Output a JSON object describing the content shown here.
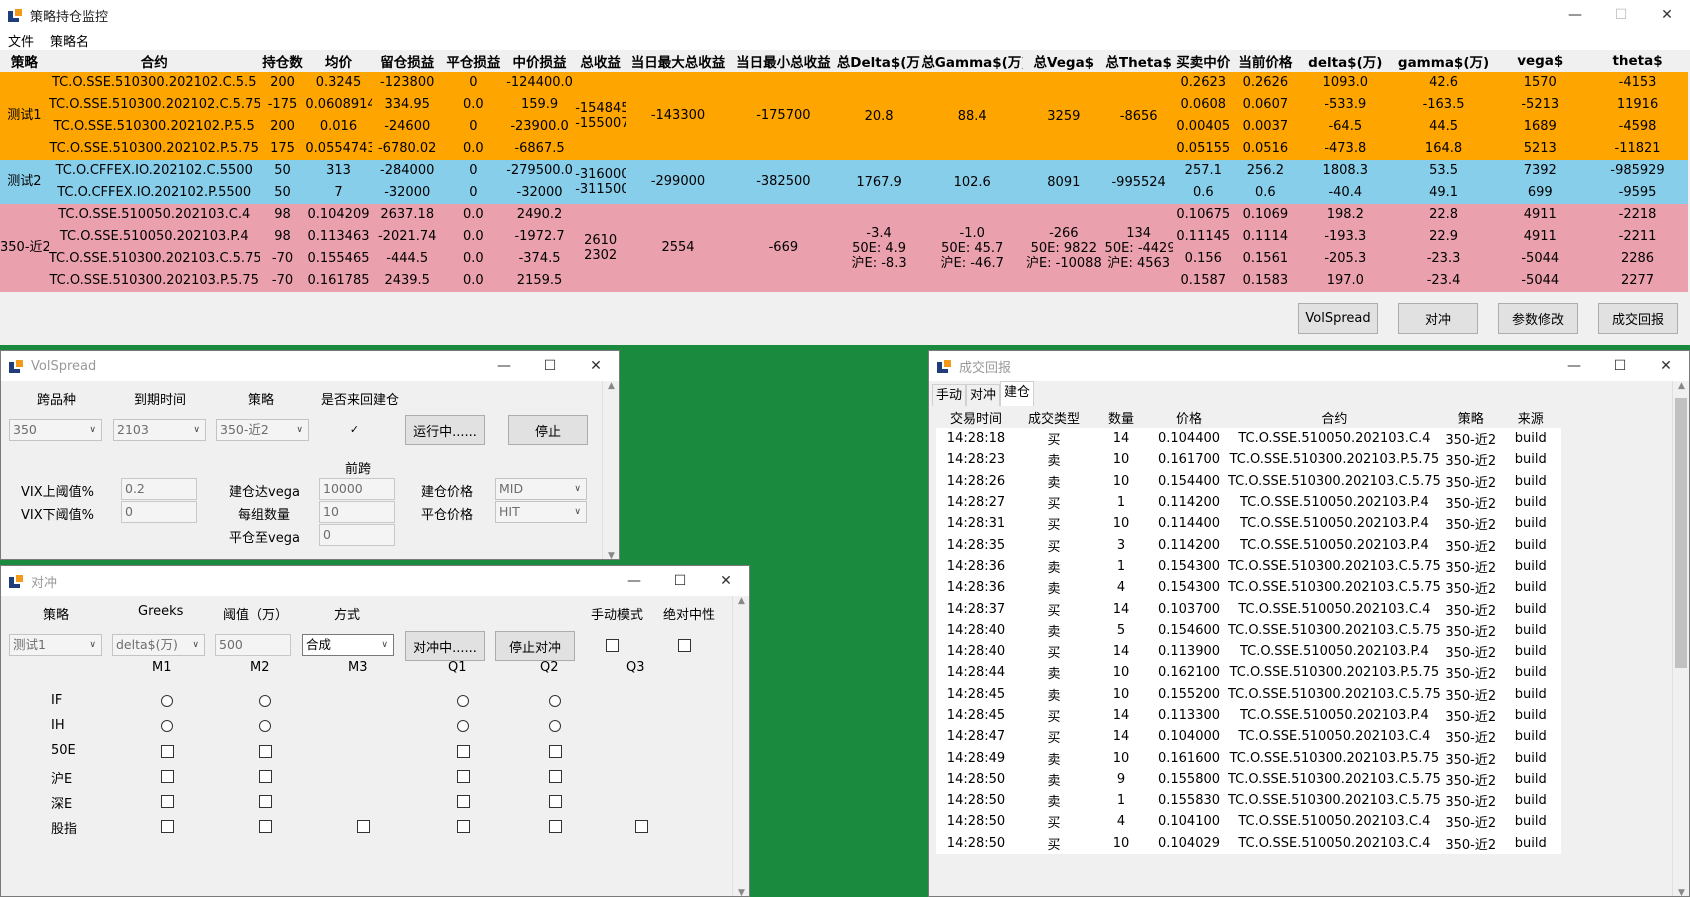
{
  "main": {
    "title": "策略持仓监控",
    "menu": [
      "文件",
      "策略名"
    ],
    "columns": [
      "策略",
      "合约",
      "持仓数",
      "均价",
      "留仓损益",
      "平仓损益",
      "中价损益",
      "总收益",
      "当日最大总收益",
      "当日最小总收益",
      "总Delta$(万)",
      "总Gamma$(万)",
      "总Vega$",
      "总Theta$",
      "买卖中价",
      "当前价格",
      "delta$(万)",
      "gamma$(万)",
      "vega$",
      "theta$"
    ],
    "groups": [
      {
        "name": "测试1",
        "color": "#ffa500",
        "total": [
          "-154845",
          "-155007"
        ],
        "max": "-143300",
        "min": "-175700",
        "delta": [
          "20.8"
        ],
        "gamma": [
          "88.4"
        ],
        "vega": [
          "3259"
        ],
        "theta": [
          "-8656"
        ],
        "rows": [
          [
            "TC.O.SSE.510300.202102.C.5.5",
            "200",
            "0.3245",
            "-123800",
            "0",
            "-124400.0",
            "0.2623",
            "0.2626",
            "1093.0",
            "42.6",
            "1570",
            "-4153"
          ],
          [
            "TC.O.SSE.510300.202102.C.5.75",
            "-175",
            "0.0608914",
            "334.95",
            "0.0",
            "159.9",
            "0.0608",
            "0.0607",
            "-533.9",
            "-163.5",
            "-5213",
            "11916"
          ],
          [
            "TC.O.SSE.510300.202102.P.5.5",
            "200",
            "0.016",
            "-24600",
            "0",
            "-23900.0",
            "0.00405",
            "0.0037",
            "-64.5",
            "44.5",
            "1689",
            "-4598"
          ],
          [
            "TC.O.SSE.510300.202102.P.5.75",
            "175",
            "0.0554743",
            "-6780.02",
            "0.0",
            "-6867.5",
            "0.05155",
            "0.0516",
            "-473.8",
            "164.8",
            "5213",
            "-11821"
          ]
        ]
      },
      {
        "name": "测试2",
        "color": "#87ceeb",
        "total": [
          "-316000",
          "-311500"
        ],
        "max": "-299000",
        "min": "-382500",
        "delta": [
          "1767.9"
        ],
        "gamma": [
          "102.6"
        ],
        "vega": [
          "8091"
        ],
        "theta": [
          "-995524"
        ],
        "rows": [
          [
            "TC.O.CFFEX.IO.202102.C.5500",
            "50",
            "313",
            "-284000",
            "0",
            "-279500.0",
            "257.1",
            "256.2",
            "1808.3",
            "53.5",
            "7392",
            "-985929"
          ],
          [
            "TC.O.CFFEX.IO.202102.P.5500",
            "50",
            "7",
            "-32000",
            "0",
            "-32000",
            "0.6",
            "0.6",
            "-40.4",
            "49.1",
            "699",
            "-9595"
          ]
        ]
      },
      {
        "name": "350-近2",
        "color": "#eaa0ad",
        "total": [
          "2610",
          "2302"
        ],
        "max": "2554",
        "min": "-669",
        "delta": [
          "-3.4",
          "50E: 4.9",
          "沪E: -8.3"
        ],
        "gamma": [
          "-1.0",
          "50E: 45.7",
          "沪E: -46.7"
        ],
        "vega": [
          "-266",
          "50E: 9822",
          "沪E: -10088"
        ],
        "theta": [
          "134",
          "50E: -4429",
          "沪E: 4563"
        ],
        "rows": [
          [
            "TC.O.SSE.510050.202103.C.4",
            "98",
            "0.104209",
            "2637.18",
            "0.0",
            "2490.2",
            "0.10675",
            "0.1069",
            "198.2",
            "22.8",
            "4911",
            "-2218"
          ],
          [
            "TC.O.SSE.510050.202103.P.4",
            "98",
            "0.113463",
            "-2021.74",
            "0.0",
            "-1972.7",
            "0.11145",
            "0.1114",
            "-193.3",
            "22.9",
            "4911",
            "-2211"
          ],
          [
            "TC.O.SSE.510300.202103.C.5.75",
            "-70",
            "0.155465",
            "-444.5",
            "0.0",
            "-374.5",
            "0.156",
            "0.1561",
            "-205.3",
            "-23.3",
            "-5044",
            "2286"
          ],
          [
            "TC.O.SSE.510300.202103.P.5.75",
            "-70",
            "0.161785",
            "2439.5",
            "0.0",
            "2159.5",
            "0.1587",
            "0.1583",
            "197.0",
            "-23.4",
            "-5044",
            "2277"
          ]
        ]
      }
    ],
    "buttons": [
      "VolSpread",
      "对冲",
      "参数修改",
      "成交回报"
    ]
  },
  "volspread": {
    "title": "VolSpread",
    "labels": {
      "product": "跨品种",
      "expiry": "到期时间",
      "strategy": "策略",
      "reopen": "是否来回建仓",
      "front": "前跨",
      "vix_up": "VIX上阈值%",
      "vix_down": "VIX下阈值%",
      "open_vega": "建仓达vega",
      "per_group": "每组数量",
      "close_vega": "平仓至vega",
      "open_price": "建仓价格",
      "close_price": "平仓价格"
    },
    "values": {
      "product": "350",
      "expiry": "2103",
      "strategy": "350-近2",
      "vix_up": "0.2",
      "vix_down": "0",
      "open_vega": "10000",
      "per_group": "10",
      "close_vega": "0",
      "open_price": "MID",
      "close_price": "HIT"
    },
    "run_btn": "运行中......",
    "stop_btn": "停止",
    "reopen_checked": "✓"
  },
  "hedge": {
    "title": "对冲",
    "labels": {
      "strategy": "策略",
      "greeks": "Greeks",
      "threshold": "阈值（万）",
      "mode": "方式",
      "manual": "手动模式",
      "neutral": "绝对中性"
    },
    "values": {
      "strategy": "测试1",
      "greeks": "delta$(万)",
      "threshold": "500",
      "mode": "合成"
    },
    "hedge_btn": "对冲中......",
    "stop_btn": "停止对冲",
    "cols": [
      "M1",
      "M2",
      "M3",
      "Q1",
      "Q2",
      "Q3"
    ],
    "rows": [
      "IF",
      "IH",
      "50E",
      "沪E",
      "深E",
      "股指"
    ]
  },
  "trades": {
    "title": "成交回报",
    "tabs": [
      "手动",
      "对冲",
      "建仓"
    ],
    "columns": [
      "交易时间",
      "成交类型",
      "数量",
      "价格",
      "合约",
      "策略",
      "来源"
    ],
    "rows": [
      [
        "14:28:18",
        "买",
        "14",
        "0.104400",
        "TC.O.SSE.510050.202103.C.4",
        "350-近2",
        "build"
      ],
      [
        "14:28:23",
        "卖",
        "10",
        "0.161700",
        "TC.O.SSE.510300.202103.P.5.75",
        "350-近2",
        "build"
      ],
      [
        "14:28:26",
        "卖",
        "10",
        "0.154400",
        "TC.O.SSE.510300.202103.C.5.75",
        "350-近2",
        "build"
      ],
      [
        "14:28:27",
        "买",
        "1",
        "0.114200",
        "TC.O.SSE.510050.202103.P.4",
        "350-近2",
        "build"
      ],
      [
        "14:28:31",
        "买",
        "10",
        "0.114400",
        "TC.O.SSE.510050.202103.P.4",
        "350-近2",
        "build"
      ],
      [
        "14:28:35",
        "买",
        "3",
        "0.114200",
        "TC.O.SSE.510050.202103.P.4",
        "350-近2",
        "build"
      ],
      [
        "14:28:36",
        "卖",
        "1",
        "0.154300",
        "TC.O.SSE.510300.202103.C.5.75",
        "350-近2",
        "build"
      ],
      [
        "14:28:36",
        "卖",
        "4",
        "0.154300",
        "TC.O.SSE.510300.202103.C.5.75",
        "350-近2",
        "build"
      ],
      [
        "14:28:37",
        "买",
        "14",
        "0.103700",
        "TC.O.SSE.510050.202103.C.4",
        "350-近2",
        "build"
      ],
      [
        "14:28:40",
        "卖",
        "5",
        "0.154600",
        "TC.O.SSE.510300.202103.C.5.75",
        "350-近2",
        "build"
      ],
      [
        "14:28:40",
        "买",
        "14",
        "0.113900",
        "TC.O.SSE.510050.202103.P.4",
        "350-近2",
        "build"
      ],
      [
        "14:28:44",
        "卖",
        "10",
        "0.162100",
        "TC.O.SSE.510300.202103.P.5.75",
        "350-近2",
        "build"
      ],
      [
        "14:28:45",
        "卖",
        "10",
        "0.155200",
        "TC.O.SSE.510300.202103.C.5.75",
        "350-近2",
        "build"
      ],
      [
        "14:28:45",
        "买",
        "14",
        "0.113300",
        "TC.O.SSE.510050.202103.P.4",
        "350-近2",
        "build"
      ],
      [
        "14:28:47",
        "买",
        "14",
        "0.104000",
        "TC.O.SSE.510050.202103.C.4",
        "350-近2",
        "build"
      ],
      [
        "14:28:49",
        "卖",
        "10",
        "0.161600",
        "TC.O.SSE.510300.202103.P.5.75",
        "350-近2",
        "build"
      ],
      [
        "14:28:50",
        "卖",
        "9",
        "0.155800",
        "TC.O.SSE.510300.202103.C.5.75",
        "350-近2",
        "build"
      ],
      [
        "14:28:50",
        "卖",
        "1",
        "0.155830",
        "TC.O.SSE.510300.202103.C.5.75",
        "350-近2",
        "build"
      ],
      [
        "14:28:50",
        "买",
        "4",
        "0.104100",
        "TC.O.SSE.510050.202103.C.4",
        "350-近2",
        "build"
      ],
      [
        "14:28:50",
        "买",
        "10",
        "0.104029",
        "TC.O.SSE.510050.202103.C.4",
        "350-近2",
        "build"
      ]
    ]
  }
}
